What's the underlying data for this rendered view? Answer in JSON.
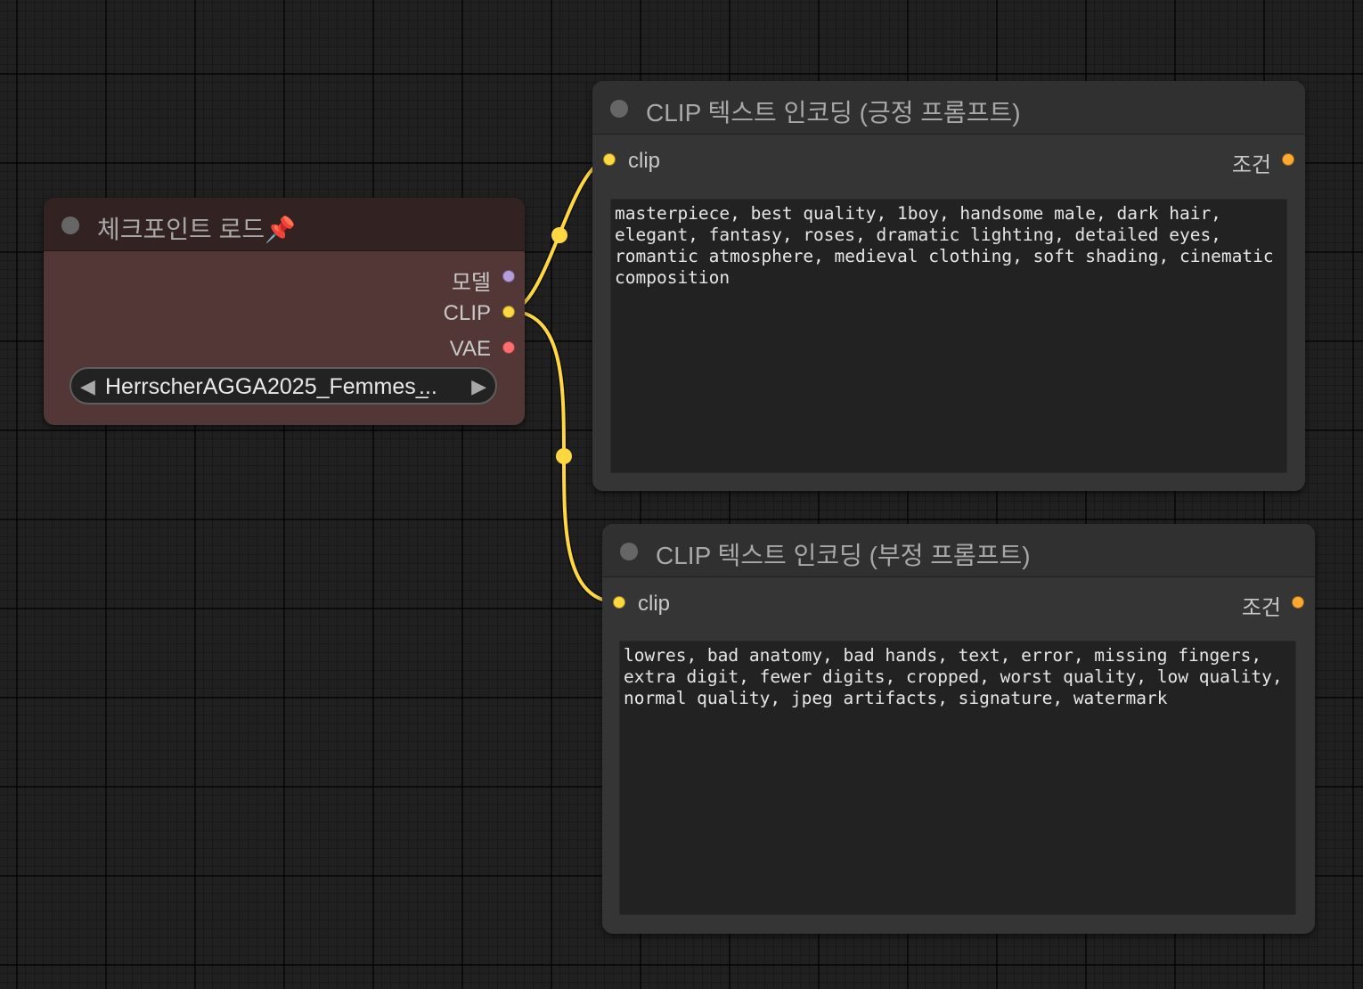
{
  "canvas": {
    "background": "#202020"
  },
  "checkpoint_node": {
    "title": "체크포인트 로드📌",
    "outputs": [
      {
        "label": "모델",
        "color": "#b39ddb"
      },
      {
        "label": "CLIP",
        "color": "#ffd740"
      },
      {
        "label": "VAE",
        "color": "#ff6e6e"
      }
    ],
    "checkpoint_select": {
      "value": "HerrscherAGGA2025_Femmes_",
      "ellipsis": "...",
      "left_arrow": "◀",
      "right_arrow": "▶"
    },
    "header_color": "#332222",
    "body_color": "#533636"
  },
  "positive_node": {
    "title": "CLIP 텍스트 인코딩 (긍정 프롬프트)",
    "input_label": "clip",
    "output_label": "조건",
    "prompt_text": "masterpiece, best quality, 1boy, handsome male, dark hair, elegant, fantasy, roses, dramatic lighting, detailed eyes, romantic atmosphere, medieval clothing, soft shading, cinematic composition"
  },
  "negative_node": {
    "title": "CLIP 텍스트 인코딩 (부정 프롬프트)",
    "input_label": "clip",
    "output_label": "조건",
    "prompt_text": "lowres, bad anatomy, bad hands, text, error, missing fingers, extra digit, fewer digits, cropped, worst quality, low quality, normal quality, jpeg artifacts, signature, watermark"
  },
  "colors": {
    "clip_link": "#ffd740",
    "conditioning": "#ffa931",
    "model": "#b39ddb",
    "vae": "#ff6e6e"
  }
}
